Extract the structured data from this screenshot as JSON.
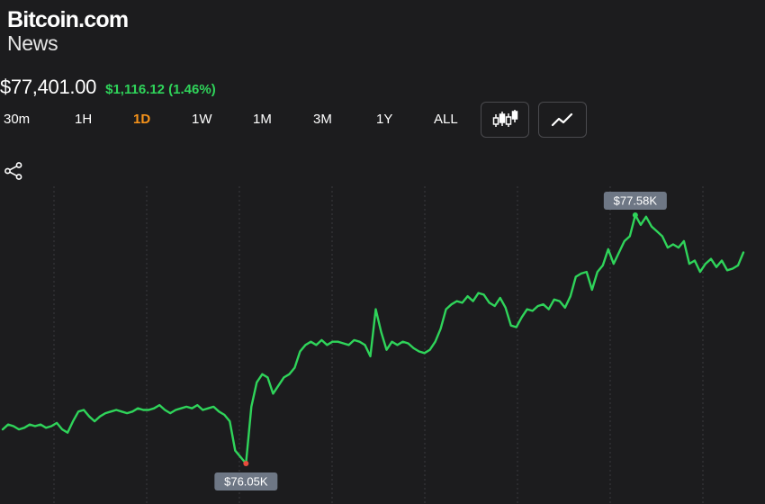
{
  "header": {
    "brand": "Bitcoin.com",
    "sub": "News"
  },
  "price": {
    "value": "$77,401.00",
    "change": "$1,116.12 (1.46%)",
    "change_color": "#2fd45a"
  },
  "timeframes": [
    {
      "label": "30m",
      "active": false
    },
    {
      "label": "1H",
      "active": false
    },
    {
      "label": "1D",
      "active": true
    },
    {
      "label": "1W",
      "active": false
    },
    {
      "label": "1M",
      "active": false
    },
    {
      "label": "3M",
      "active": false
    },
    {
      "label": "1Y",
      "active": false
    },
    {
      "label": "ALL",
      "active": false
    }
  ],
  "controls": {
    "candlestick_icon": "candlestick-icon",
    "line_icon": "line-chart-icon",
    "share_icon": "share-icon"
  },
  "colors": {
    "accent": "#f7931a",
    "line": "#2fd45a",
    "low_marker": "#e84c3d",
    "tooltip_bg": "#6e7785"
  },
  "chart_data": {
    "type": "line",
    "grid": "vertical-dashed",
    "series": [
      {
        "values": [
          76.26,
          76.29,
          76.28,
          76.26,
          76.27,
          76.29,
          76.28,
          76.29,
          76.27,
          76.28,
          76.3,
          76.26,
          76.24,
          76.31,
          76.37,
          76.38,
          76.34,
          76.31,
          76.34,
          76.36,
          76.37,
          76.38,
          76.37,
          76.36,
          76.37,
          76.39,
          76.38,
          76.38,
          76.39,
          76.41,
          76.38,
          76.36,
          76.38,
          76.39,
          76.4,
          76.39,
          76.41,
          76.38,
          76.39,
          76.4,
          76.37,
          76.35,
          76.31,
          76.13,
          76.09,
          76.05,
          76.4,
          76.55,
          76.6,
          76.58,
          76.48,
          76.53,
          76.58,
          76.6,
          76.64,
          76.74,
          76.78,
          76.8,
          76.78,
          76.81,
          76.78,
          76.8,
          76.8,
          76.79,
          76.78,
          76.81,
          76.8,
          76.78,
          76.71,
          77.0,
          76.86,
          76.75,
          76.8,
          76.78,
          76.8,
          76.79,
          76.76,
          76.74,
          76.73,
          76.75,
          76.8,
          76.88,
          77.0,
          77.03,
          77.05,
          77.04,
          77.08,
          77.05,
          77.1,
          77.09,
          77.04,
          77.02,
          77.07,
          77.01,
          76.9,
          76.89,
          76.95,
          77.0,
          76.99,
          77.02,
          77.03,
          77.0,
          77.06,
          77.05,
          77.01,
          77.08,
          77.2,
          77.22,
          77.23,
          77.12,
          77.23,
          77.27,
          77.37,
          77.28,
          77.35,
          77.42,
          77.45,
          77.58,
          77.52,
          77.57,
          77.51,
          77.48,
          77.45,
          77.38,
          77.4,
          77.38,
          77.42,
          77.28,
          77.3,
          77.23,
          77.28,
          77.31,
          77.26,
          77.3,
          77.24,
          77.25,
          77.27,
          77.35
        ],
        "low": {
          "label": "$76.05K",
          "value": 76.05
        },
        "high": {
          "label": "$77.58K",
          "value": 77.58
        }
      }
    ]
  }
}
